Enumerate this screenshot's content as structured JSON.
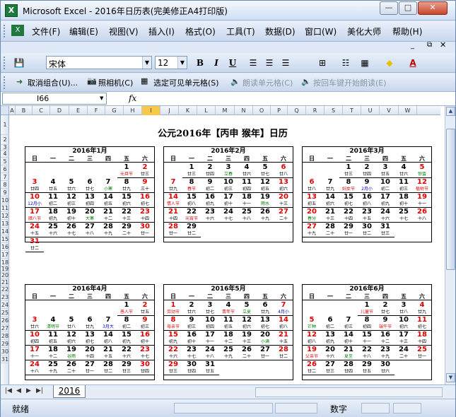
{
  "window": {
    "title": "Microsoft Excel - 2016年日历表(完美修正A4打印版)",
    "app_icon": "X",
    "min": "0",
    "max": "1",
    "close": "r"
  },
  "menu": [
    "文件(F)",
    "编辑(E)",
    "视图(V)",
    "插入(I)",
    "格式(O)",
    "工具(T)",
    "数据(D)",
    "窗口(W)",
    "美化大师",
    "帮助(H)"
  ],
  "toolbar": {
    "font": "宋体",
    "size": "12",
    "bold": "B",
    "italic": "I",
    "underline": "U"
  },
  "toolbar2": [
    "取消组合(U)...",
    "照相机(C)",
    "选定可见单元格(S)",
    "朗读单元格(C)",
    "按回车键开始朗读(E)"
  ],
  "namebox": "I66",
  "fx": "fx",
  "columns": [
    "A",
    "B",
    "C",
    "D",
    "E",
    "F",
    "G",
    "H",
    "I",
    "J",
    "K",
    "L",
    "M",
    "N",
    "O",
    "P",
    "Q",
    "R",
    "S",
    "T",
    "U",
    "V",
    "W"
  ],
  "rows": [
    "1",
    "2",
    "3",
    "4",
    "5",
    "6",
    "7",
    "8",
    "9",
    "10",
    "11",
    "12",
    "13",
    "14",
    "15",
    "16",
    "17",
    "18",
    "19",
    "20",
    "21",
    "22",
    "23",
    "24",
    "25",
    "26",
    "27",
    "28",
    "29",
    "30",
    "31"
  ],
  "calendar_title": "公元2016年【丙申 猴年】日历",
  "weekdays": [
    "日",
    "一",
    "二",
    "三",
    "四",
    "五",
    "六"
  ],
  "months": [
    {
      "title": "2016年1月",
      "start": 5,
      "days": 31,
      "lunar": [
        "元旦节",
        "廿三",
        "廿四",
        "廿五",
        "廿六",
        "廿七",
        "小寒",
        "廿九",
        "三十",
        "12月小",
        "初二",
        "初三",
        "初四",
        "初五",
        "初六",
        "初七",
        "腊八节",
        "初九",
        "初十",
        "大寒",
        "十二",
        "十三",
        "十四",
        "十五",
        "十六",
        "十七",
        "十八",
        "十九",
        "二十",
        "廿一",
        "廿二"
      ]
    },
    {
      "title": "2016年2月",
      "start": 1,
      "days": 29,
      "lunar": [
        "廿三",
        "廿四",
        "立春",
        "廿六",
        "廿七",
        "廿八",
        "廿九",
        "春节",
        "初二",
        "初三",
        "初四",
        "初五",
        "初六",
        "情人节",
        "初八",
        "初九",
        "初十",
        "十一",
        "雨水",
        "十三",
        "十四",
        "元宵节",
        "十六",
        "十七",
        "十八",
        "十九",
        "二十",
        "廿一",
        "廿二"
      ]
    },
    {
      "title": "2016年3月",
      "start": 2,
      "days": 31,
      "lunar": [
        "廿三",
        "廿四",
        "廿五",
        "廿六",
        "惊蛰",
        "廿八",
        "廿九",
        "妇女节",
        "2月小",
        "初二",
        "初三",
        "植树节",
        "初五",
        "初六",
        "初七",
        "初八",
        "初九",
        "初十",
        "十一",
        "春分",
        "十三",
        "十四",
        "十五",
        "十六",
        "十七",
        "十八",
        "十九",
        "二十",
        "廿一",
        "廿二",
        "廿三"
      ]
    },
    {
      "title": "2016年4月",
      "start": 5,
      "days": 30,
      "lunar": [
        "愚人节",
        "廿五",
        "廿六",
        "清明节",
        "廿八",
        "廿九",
        "3月大",
        "初二",
        "初三",
        "初四",
        "初五",
        "初六",
        "初七",
        "初八",
        "初九",
        "初十",
        "十一",
        "十二",
        "谷雨",
        "十四",
        "十五",
        "十六",
        "十七",
        "十八",
        "十九",
        "二十",
        "廿一",
        "廿二",
        "廿三",
        "廿四"
      ]
    },
    {
      "title": "2016年5月",
      "start": 0,
      "days": 31,
      "lunar": [
        "劳动节",
        "廿六",
        "廿七",
        "青年节",
        "立夏",
        "廿九",
        "4月小",
        "母亲节",
        "初三",
        "初四",
        "初五",
        "初六",
        "初七",
        "初八",
        "初九",
        "初十",
        "十一",
        "十二",
        "十三",
        "小满",
        "十五",
        "十六",
        "十七",
        "十八",
        "十九",
        "二十",
        "廿一",
        "廿二",
        "廿三",
        "廿四",
        "廿五"
      ]
    },
    {
      "title": "2016年6月",
      "start": 3,
      "days": 30,
      "lunar": [
        "儿童节",
        "廿七",
        "廿八",
        "廿九",
        "芒种",
        "初二",
        "初三",
        "初四",
        "端午节",
        "初六",
        "初七",
        "初八",
        "初九",
        "初十",
        "十一",
        "十二",
        "十三",
        "十四",
        "父亲节",
        "十六",
        "夏至",
        "十八",
        "十九",
        "二十",
        "廿一",
        "廿二",
        "廿三",
        "廿四",
        "廿五",
        "廿六"
      ]
    }
  ],
  "sheet_tab": "2016",
  "status": {
    "left": "就绪",
    "right": "数字"
  }
}
